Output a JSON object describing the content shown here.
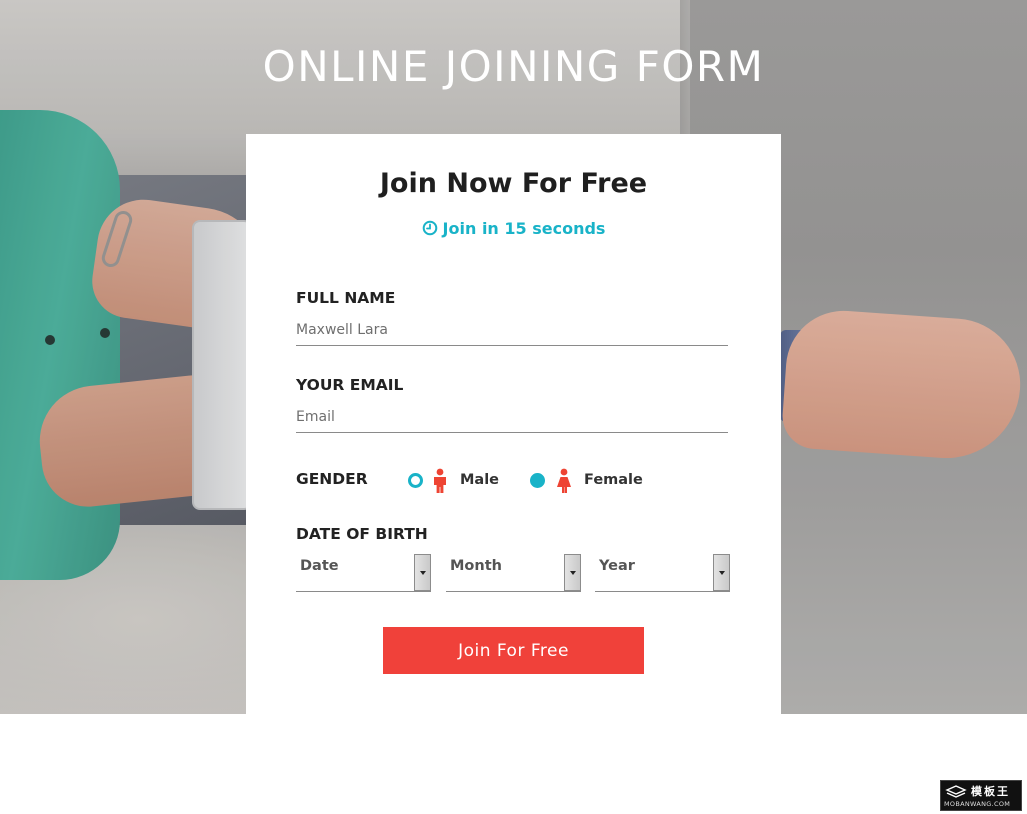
{
  "page": {
    "title": "ONLINE JOINING FORM"
  },
  "form": {
    "heading": "Join Now For Free",
    "subtitle": "Join in 15 seconds",
    "full_name": {
      "label": "FULL NAME",
      "placeholder": "Maxwell Lara"
    },
    "email": {
      "label": "YOUR EMAIL",
      "placeholder": "Email"
    },
    "gender": {
      "label": "GENDER",
      "options": [
        {
          "label": "Male",
          "icon": "male-icon",
          "checked": false
        },
        {
          "label": "Female",
          "icon": "female-icon",
          "checked": true
        }
      ]
    },
    "dob": {
      "label": "DATE OF BIRTH",
      "date": "Date",
      "month": "Month",
      "year": "Year"
    },
    "submit_label": "Join For Free"
  },
  "watermark": {
    "cn": "模板王",
    "en": "MOBANWANG.COM"
  },
  "colors": {
    "accent": "#19b3c8",
    "button": "#f0413a",
    "person_icon": "#ee4433"
  }
}
